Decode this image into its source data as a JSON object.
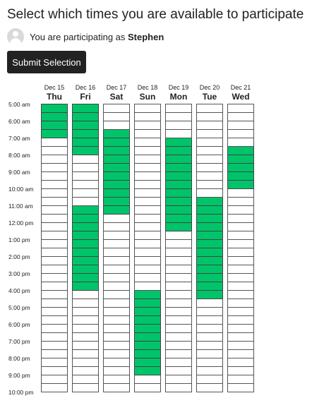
{
  "header": {
    "title": "Select which times you are available to participate",
    "participating_prefix": "You are participating as ",
    "user_name": "Stephen",
    "submit_label": "Submit Selection"
  },
  "colors": {
    "selected": "#00c46a",
    "button": "#222222"
  },
  "days": [
    {
      "date": "Dec 15",
      "name": "Thu",
      "selected_slots": [
        [
          0,
          4
        ]
      ]
    },
    {
      "date": "Dec 16",
      "name": "Fri",
      "selected_slots": [
        [
          0,
          6
        ],
        [
          12,
          22
        ]
      ]
    },
    {
      "date": "Dec 17",
      "name": "Sat",
      "selected_slots": [
        [
          3,
          13
        ]
      ]
    },
    {
      "date": "Dec 18",
      "name": "Sun",
      "selected_slots": [
        [
          22,
          32
        ]
      ]
    },
    {
      "date": "Dec 19",
      "name": "Mon",
      "selected_slots": [
        [
          4,
          15
        ]
      ]
    },
    {
      "date": "Dec 20",
      "name": "Tue",
      "selected_slots": [
        [
          11,
          23
        ]
      ]
    },
    {
      "date": "Dec 21",
      "name": "Wed",
      "selected_slots": [
        [
          5,
          10
        ]
      ]
    }
  ],
  "time_labels": [
    "5:00 am",
    "6:00 am",
    "7:00 am",
    "8:00 am",
    "9:00 am",
    "10:00 am",
    "11:00 am",
    "12:00 pm",
    "1:00 pm",
    "2:00 pm",
    "3:00 pm",
    "4:00 pm",
    "5:00 pm",
    "6:00 pm",
    "7:00 pm",
    "8:00 pm",
    "9:00 pm",
    "10:00 pm"
  ],
  "slots_per_day": 34
}
